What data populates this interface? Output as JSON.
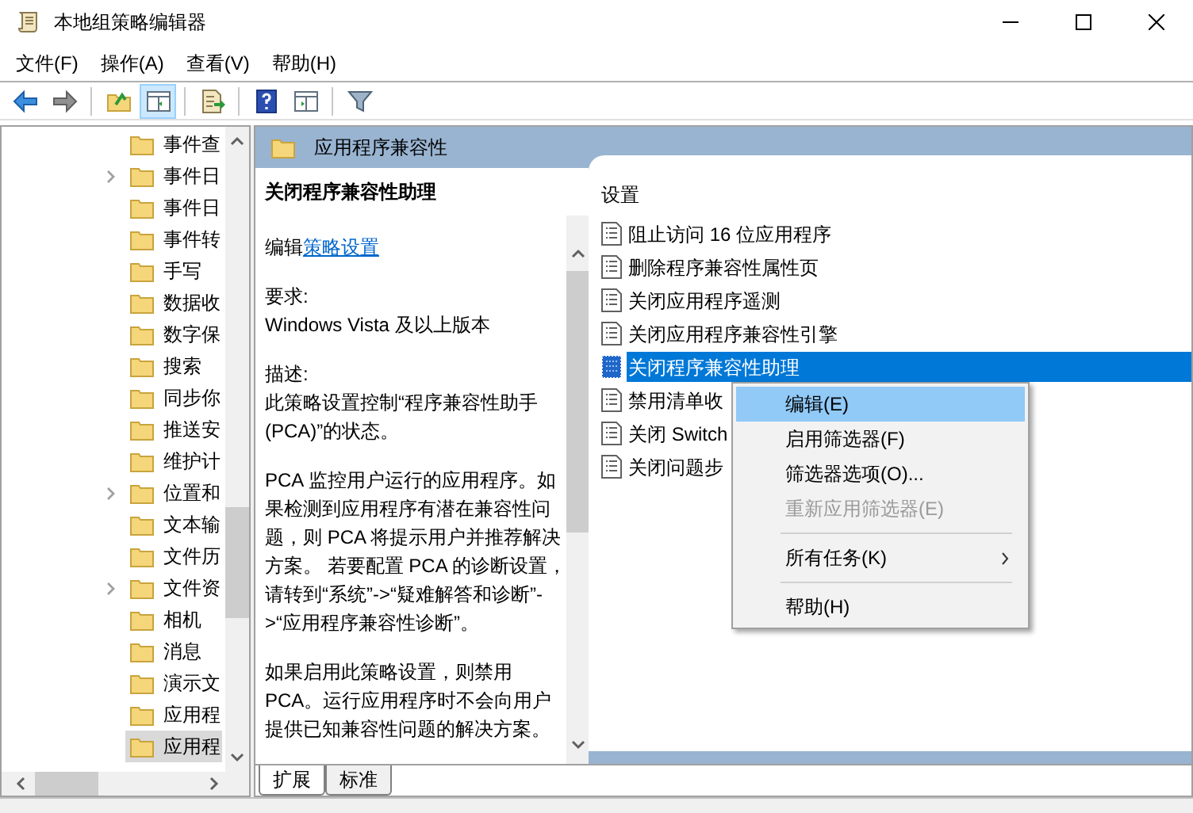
{
  "window": {
    "title": "本地组策略编辑器"
  },
  "menu": [
    "文件(F)",
    "操作(A)",
    "查看(V)",
    "帮助(H)"
  ],
  "toolbar": [
    {
      "kind": "back",
      "pressed": false
    },
    {
      "kind": "forward",
      "pressed": false
    },
    {
      "kind": "up",
      "pressed": false
    },
    {
      "kind": "tree",
      "pressed": true
    },
    {
      "kind": "export",
      "pressed": false
    },
    {
      "kind": "help",
      "pressed": false
    },
    {
      "kind": "view",
      "pressed": false
    },
    {
      "kind": "filter",
      "pressed": false
    }
  ],
  "tree": {
    "items": [
      {
        "label": "事件查",
        "expandable": false,
        "selected": false
      },
      {
        "label": "事件日",
        "expandable": true,
        "selected": false
      },
      {
        "label": "事件日",
        "expandable": false,
        "selected": false
      },
      {
        "label": "事件转",
        "expandable": false,
        "selected": false
      },
      {
        "label": "手写",
        "expandable": false,
        "selected": false
      },
      {
        "label": "数据收",
        "expandable": false,
        "selected": false
      },
      {
        "label": "数字保",
        "expandable": false,
        "selected": false
      },
      {
        "label": "搜索",
        "expandable": false,
        "selected": false
      },
      {
        "label": "同步你",
        "expandable": false,
        "selected": false
      },
      {
        "label": "推送安",
        "expandable": false,
        "selected": false
      },
      {
        "label": "维护计",
        "expandable": false,
        "selected": false
      },
      {
        "label": "位置和",
        "expandable": true,
        "selected": false
      },
      {
        "label": "文本输",
        "expandable": false,
        "selected": false
      },
      {
        "label": "文件历",
        "expandable": false,
        "selected": false
      },
      {
        "label": "文件资",
        "expandable": true,
        "selected": false
      },
      {
        "label": "相机",
        "expandable": false,
        "selected": false
      },
      {
        "label": "消息",
        "expandable": false,
        "selected": false
      },
      {
        "label": "演示文",
        "expandable": false,
        "selected": false
      },
      {
        "label": "应用程",
        "expandable": false,
        "selected": false
      },
      {
        "label": "应用程",
        "expandable": false,
        "selected": true
      }
    ]
  },
  "header": {
    "title": "应用程序兼容性"
  },
  "description": {
    "title": "关闭程序兼容性助理",
    "edit_prefix": "编辑",
    "edit_link": "策略设置",
    "sections": [
      {
        "label": "要求:",
        "text": "Windows Vista 及以上版本"
      },
      {
        "label": "描述:",
        "text": "此策略设置控制“程序兼容性助手 (PCA)”的状态。"
      }
    ],
    "paragraphs": [
      "PCA 监控用户运行的应用程序。如果检测到应用程序有潜在兼容性问题，则 PCA 将提示用户并推荐解决方案。 若要配置 PCA 的诊断设置，请转到“系统”->“疑难解答和诊断”->“应用程序兼容性诊断”。",
      "如果启用此策略设置，则禁用 PCA。运行应用程序时不会向用户提供已知兼容性问题的解决方案。"
    ]
  },
  "tabs": [
    {
      "label": "扩展",
      "selected": true
    },
    {
      "label": "标准",
      "selected": false
    }
  ],
  "settings": {
    "column": "设置",
    "items": [
      {
        "label": "阻止访问 16 位应用程序",
        "selected": false
      },
      {
        "label": "删除程序兼容性属性页",
        "selected": false
      },
      {
        "label": "关闭应用程序遥测",
        "selected": false
      },
      {
        "label": "关闭应用程序兼容性引擎",
        "selected": false
      },
      {
        "label": "关闭程序兼容性助理",
        "selected": true
      },
      {
        "label": "禁用清单收",
        "selected": false
      },
      {
        "label": "关闭 Switch",
        "selected": false
      },
      {
        "label": "关闭问题步",
        "selected": false
      }
    ]
  },
  "context_menu": {
    "items": [
      {
        "label": "编辑(E)",
        "highlighted": true,
        "disabled": false,
        "submenu": false,
        "separator_before": false
      },
      {
        "label": "启用筛选器(F)",
        "highlighted": false,
        "disabled": false,
        "submenu": false,
        "separator_before": false
      },
      {
        "label": "筛选器选项(O)...",
        "highlighted": false,
        "disabled": false,
        "submenu": false,
        "separator_before": false
      },
      {
        "label": "重新应用筛选器(E)",
        "highlighted": false,
        "disabled": true,
        "submenu": false,
        "separator_before": false
      },
      {
        "label": "所有任务(K)",
        "highlighted": false,
        "disabled": false,
        "submenu": true,
        "separator_before": true
      },
      {
        "label": "帮助(H)",
        "highlighted": false,
        "disabled": false,
        "submenu": false,
        "separator_before": true
      }
    ]
  }
}
